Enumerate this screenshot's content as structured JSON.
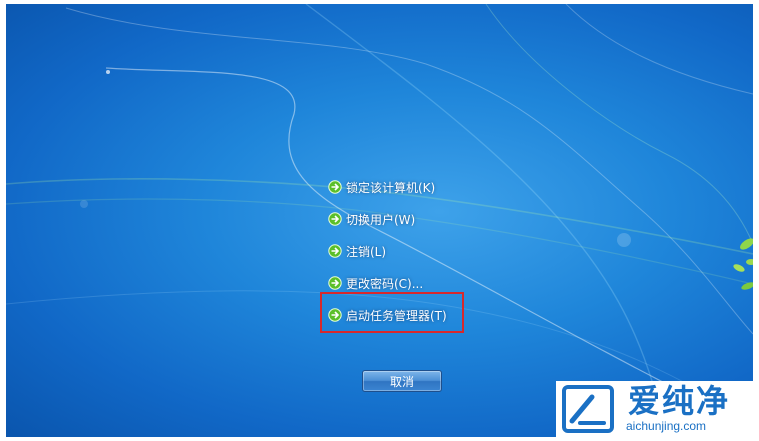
{
  "menu": {
    "items": [
      {
        "label": "锁定该计算机(K)",
        "icon": "green-arrow-icon"
      },
      {
        "label": "切换用户(W)",
        "icon": "green-arrow-icon"
      },
      {
        "label": "注销(L)",
        "icon": "green-arrow-icon"
      },
      {
        "label": "更改密码(C)...",
        "icon": "green-arrow-icon"
      },
      {
        "label": "启动任务管理器(T)",
        "icon": "green-arrow-icon"
      }
    ],
    "highlighted_item": "启动任务管理器(T)",
    "highlight_color": "#d8282c"
  },
  "cancel_button": {
    "label": "取消"
  },
  "watermark": {
    "title": "爱纯净",
    "url": "aichunjing.com",
    "color": "#1a70c4"
  },
  "colors": {
    "desktop_blue": "#1f86da",
    "icon_green": "#5cbf2a"
  }
}
